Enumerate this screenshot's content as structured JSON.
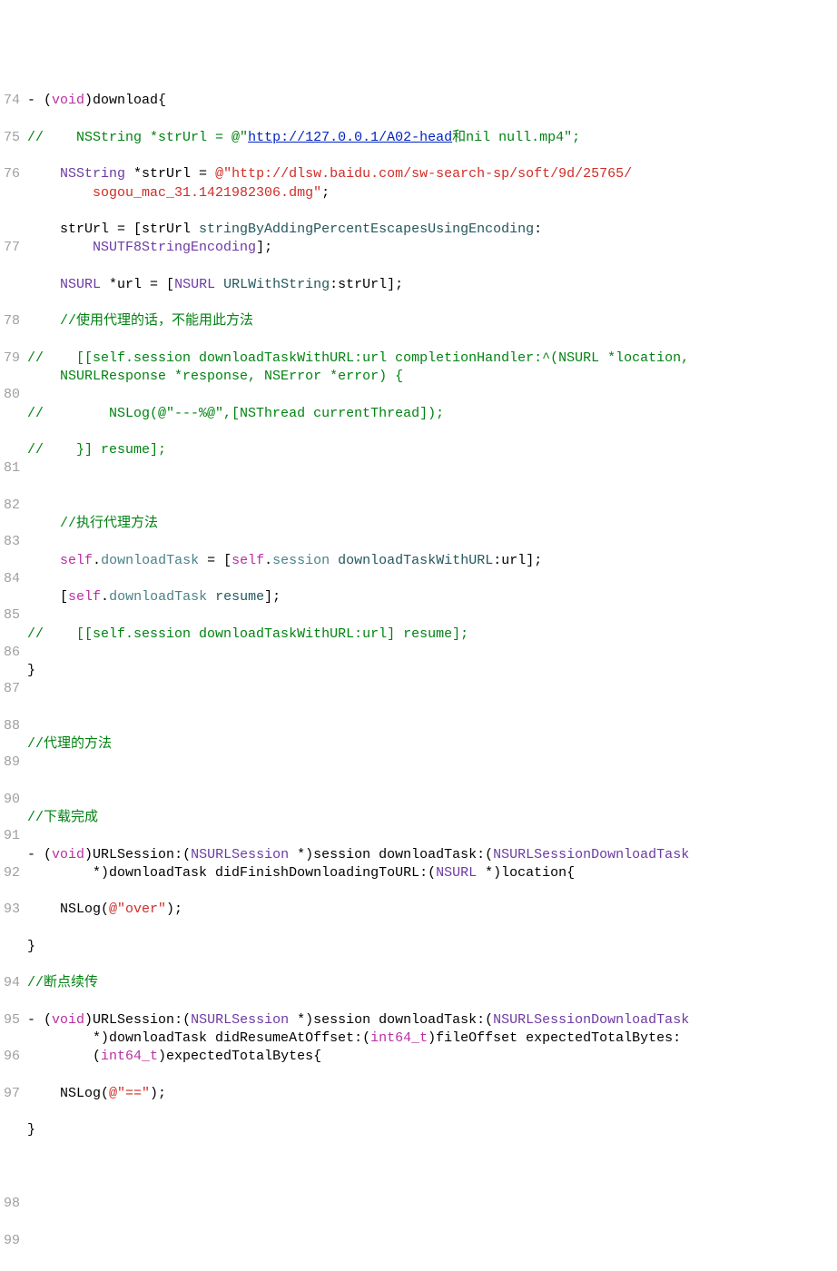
{
  "line_numbers": [
    "74",
    "75",
    "76",
    "77",
    "78",
    "79",
    "80",
    "81",
    "82",
    "83",
    "84",
    "85",
    "86",
    "87",
    "88",
    "89",
    "90",
    "91",
    "92",
    "93",
    "94",
    "95",
    "96",
    "97",
    "98",
    "99"
  ],
  "t": {
    "l74a": "- (",
    "l74_void": "void",
    "l74b": ")download{",
    "l75_pre": "//    NSString *strUrl = @\"",
    "l75_url": "http://127.0.0.1/A02-head",
    "l75_post": "和nil null.mp4\";",
    "l76a": "    ",
    "l76_type": "NSString",
    "l76b": " *strUrl = ",
    "l76_str": "@\"http://dlsw.baidu.com/sw-search-sp/soft/9d/25765/sogou_mac_31.1421982306.dmg\"",
    "l76c": ";",
    "l77a": "    strUrl = [strUrl ",
    "l77_method": "stringByAddingPercentEscapesUsingEncoding",
    "l77b": ":",
    "l77_enc": "NSUTF8StringEncoding",
    "l77c": "];",
    "l78a": "    ",
    "l78_type": "NSURL",
    "l78b": " *url = [",
    "l78_type2": "NSURL",
    "l78c": " ",
    "l78_method": "URLWithString",
    "l78d": ":strUrl];",
    "l79": "    //使用代理的话，不能用此方法",
    "l80": "//    [[self.session downloadTaskWithURL:url completionHandler:^(NSURL *location, NSURLResponse *response, NSError *error) {",
    "l81": "//        NSLog(@\"---%@\",[NSThread currentThread]);",
    "l82": "//    }] resume];",
    "l83": "    ",
    "l84": "    //执行代理方法",
    "l85a": "    ",
    "l85_self": "self",
    "l85b": ".",
    "l85_prop": "downloadTask",
    "l85c": " = [",
    "l85_self2": "self",
    "l85d": ".",
    "l85_prop2": "session",
    "l85e": " ",
    "l85_method": "downloadTaskWithURL",
    "l85f": ":url];",
    "l86a": "    [",
    "l86_self": "self",
    "l86b": ".",
    "l86_prop": "downloadTask",
    "l86c": " ",
    "l86_method": "resume",
    "l86d": "];",
    "l87": "//    [[self.session downloadTaskWithURL:url] resume];",
    "l88": "}",
    "l89": "",
    "l90": "//代理的方法",
    "l91": "",
    "l92": "//下载完成",
    "l93a": "- (",
    "l93_void": "void",
    "l93b": ")URLSession:(",
    "l93_type1": "NSURLSession",
    "l93c": " *)session downloadTask:(",
    "l93_type2": "NSURLSessionDownloadTask",
    "l93d": " *)downloadTask didFinishDownloadingToURL:(",
    "l93_type3": "NSURL",
    "l93e": " *)location{",
    "l94a": "    NSLog(",
    "l94_str": "@\"over\"",
    "l94b": ");",
    "l95": "}",
    "l96": "//断点续传",
    "l97a": "- (",
    "l97_void": "void",
    "l97b": ")URLSession:(",
    "l97_type1": "NSURLSession",
    "l97c": " *)session downloadTask:(",
    "l97_type2": "NSURLSessionDownloadTask",
    "l97d": " *)downloadTask didResumeAtOffset:(",
    "l97_type3": "int64_t",
    "l97e": ")fileOffset expectedTotalBytes:(",
    "l97_type4": "int64_t",
    "l97f": ")expectedTotalBytes{",
    "l98a": "    NSLog(",
    "l98_str": "@\"==\"",
    "l98b": ");",
    "l99": "}"
  }
}
